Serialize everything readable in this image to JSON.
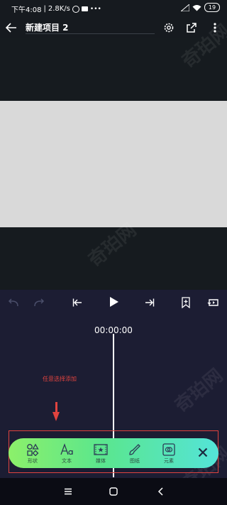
{
  "status_bar": {
    "time": "下午4:08",
    "separator": "|",
    "network_speed": "2.8K/s",
    "battery": "19"
  },
  "app_bar": {
    "title": "新建项目 2"
  },
  "editor": {
    "timecode": "00:00:00",
    "annotation": "任意选择添加"
  },
  "toolbar": {
    "items": [
      {
        "label": "形状",
        "icon": "shapes-icon"
      },
      {
        "label": "文本",
        "icon": "text-icon"
      },
      {
        "label": "媒体",
        "icon": "media-icon"
      },
      {
        "label": "图纸",
        "icon": "drawing-icon"
      },
      {
        "label": "元素",
        "icon": "elements-icon"
      }
    ]
  },
  "watermark": "奇珀网",
  "colors": {
    "background": "#1c1d33",
    "annotation": "#e0433f",
    "toolbar_start": "#8cf06a",
    "toolbar_end": "#54e4d8"
  }
}
